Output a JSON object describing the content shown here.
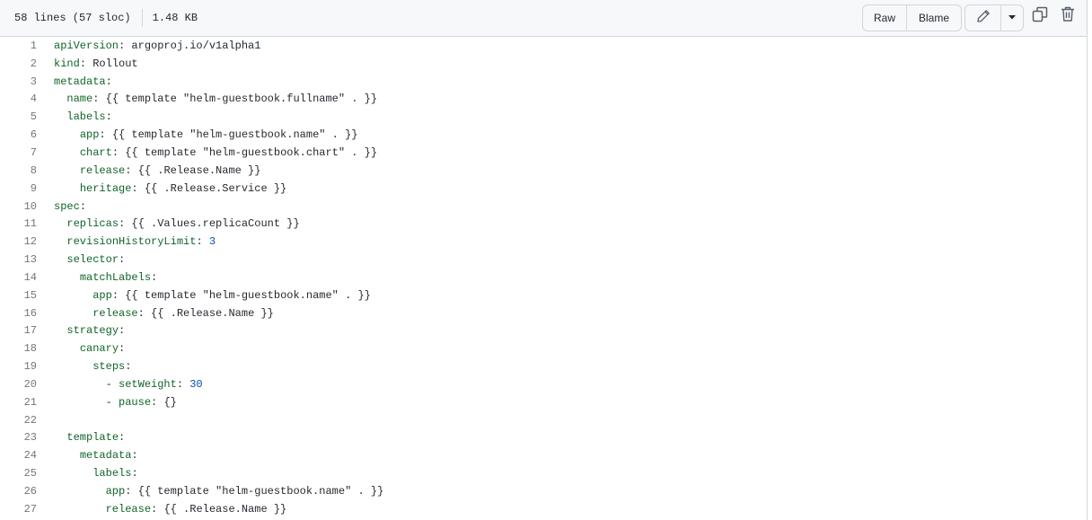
{
  "file_info": {
    "lines": "58 lines (57 sloc)",
    "size": "1.48 KB"
  },
  "toolbar": {
    "raw_label": "Raw",
    "blame_label": "Blame"
  },
  "icons": {
    "edit": "pencil-icon",
    "dropdown": "triangle-down-icon",
    "copy": "copy-icon",
    "delete": "trash-icon"
  },
  "colors": {
    "key": "#116329",
    "number": "#0550ae",
    "text": "#24292f",
    "line_number": "#6e7781",
    "header_bg": "#f6f8fa",
    "border": "#d0d7de"
  },
  "code_lines": [
    {
      "num": "1",
      "indent": "",
      "key": "apiVersion",
      "sep": ": ",
      "value": "argoproj.io/v1alpha1",
      "vtype": "p"
    },
    {
      "num": "2",
      "indent": "",
      "key": "kind",
      "sep": ": ",
      "value": "Rollout",
      "vtype": "p"
    },
    {
      "num": "3",
      "indent": "",
      "key": "metadata",
      "sep": ":",
      "value": "",
      "vtype": "p"
    },
    {
      "num": "4",
      "indent": "  ",
      "key": "name",
      "sep": ": ",
      "value": "{{ template \"helm-guestbook.fullname\" . }}",
      "vtype": "p"
    },
    {
      "num": "5",
      "indent": "  ",
      "key": "labels",
      "sep": ":",
      "value": "",
      "vtype": "p"
    },
    {
      "num": "6",
      "indent": "    ",
      "key": "app",
      "sep": ": ",
      "value": "{{ template \"helm-guestbook.name\" . }}",
      "vtype": "p"
    },
    {
      "num": "7",
      "indent": "    ",
      "key": "chart",
      "sep": ": ",
      "value": "{{ template \"helm-guestbook.chart\" . }}",
      "vtype": "p"
    },
    {
      "num": "8",
      "indent": "    ",
      "key": "release",
      "sep": ": ",
      "value": "{{ .Release.Name }}",
      "vtype": "p"
    },
    {
      "num": "9",
      "indent": "    ",
      "key": "heritage",
      "sep": ": ",
      "value": "{{ .Release.Service }}",
      "vtype": "p"
    },
    {
      "num": "10",
      "indent": "",
      "key": "spec",
      "sep": ":",
      "value": "",
      "vtype": "p"
    },
    {
      "num": "11",
      "indent": "  ",
      "key": "replicas",
      "sep": ": ",
      "value": "{{ .Values.replicaCount }}",
      "vtype": "p"
    },
    {
      "num": "12",
      "indent": "  ",
      "key": "revisionHistoryLimit",
      "sep": ": ",
      "value": "3",
      "vtype": "n"
    },
    {
      "num": "13",
      "indent": "  ",
      "key": "selector",
      "sep": ":",
      "value": "",
      "vtype": "p"
    },
    {
      "num": "14",
      "indent": "    ",
      "key": "matchLabels",
      "sep": ":",
      "value": "",
      "vtype": "p"
    },
    {
      "num": "15",
      "indent": "      ",
      "key": "app",
      "sep": ": ",
      "value": "{{ template \"helm-guestbook.name\" . }}",
      "vtype": "p"
    },
    {
      "num": "16",
      "indent": "      ",
      "key": "release",
      "sep": ": ",
      "value": "{{ .Release.Name }}",
      "vtype": "p"
    },
    {
      "num": "17",
      "indent": "  ",
      "key": "strategy",
      "sep": ":",
      "value": "",
      "vtype": "p"
    },
    {
      "num": "18",
      "indent": "    ",
      "key": "canary",
      "sep": ":",
      "value": "",
      "vtype": "p"
    },
    {
      "num": "19",
      "indent": "      ",
      "key": "steps",
      "sep": ":",
      "value": "",
      "vtype": "p"
    },
    {
      "num": "20",
      "indent": "        - ",
      "key": "setWeight",
      "sep": ": ",
      "value": "30",
      "vtype": "n"
    },
    {
      "num": "21",
      "indent": "        - ",
      "key": "pause",
      "sep": ": ",
      "value": "{}",
      "vtype": "p"
    },
    {
      "num": "22",
      "indent": "",
      "key": "",
      "sep": "",
      "value": "",
      "vtype": "p"
    },
    {
      "num": "23",
      "indent": "  ",
      "key": "template",
      "sep": ":",
      "value": "",
      "vtype": "p"
    },
    {
      "num": "24",
      "indent": "    ",
      "key": "metadata",
      "sep": ":",
      "value": "",
      "vtype": "p"
    },
    {
      "num": "25",
      "indent": "      ",
      "key": "labels",
      "sep": ":",
      "value": "",
      "vtype": "p"
    },
    {
      "num": "26",
      "indent": "        ",
      "key": "app",
      "sep": ": ",
      "value": "{{ template \"helm-guestbook.name\" . }}",
      "vtype": "p"
    },
    {
      "num": "27",
      "indent": "        ",
      "key": "release",
      "sep": ": ",
      "value": "{{ .Release.Name }}",
      "vtype": "p"
    }
  ]
}
